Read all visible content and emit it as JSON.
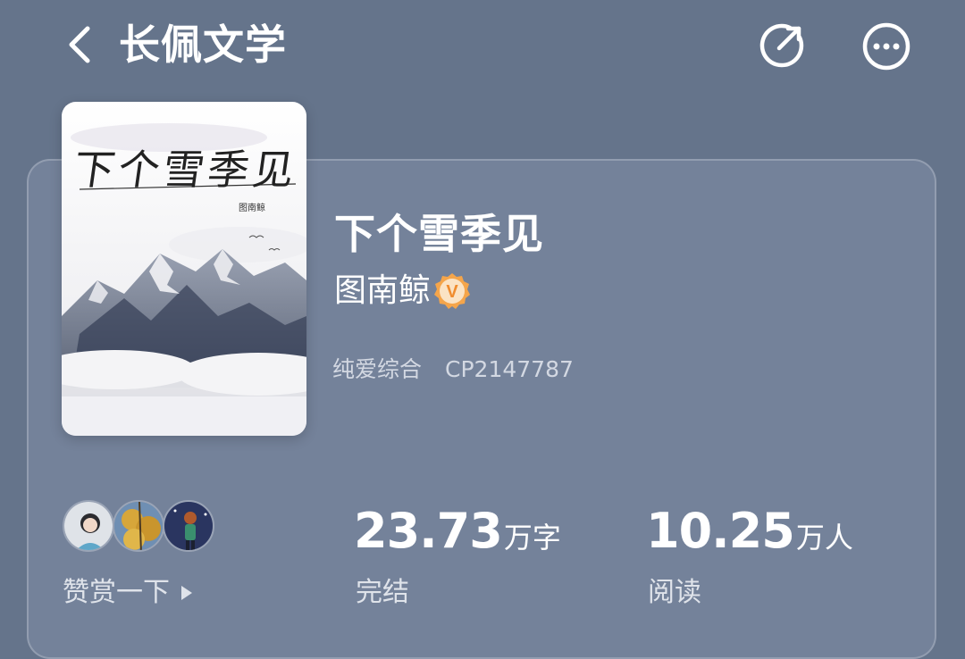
{
  "header": {
    "title": "长佩文学",
    "icons": [
      "back-icon",
      "share-icon",
      "more-icon"
    ]
  },
  "book": {
    "cover": {
      "title_text": "下个雪季见",
      "author_text": "图南鲸"
    },
    "title": "下个雪季见",
    "author": "图南鲸",
    "verified_badge": "V",
    "category": "纯爱综合",
    "cp_id": "CP2147787"
  },
  "stats": {
    "tip": {
      "label": "赞赏一下",
      "avatars": [
        "avatar-1",
        "avatar-2",
        "avatar-3"
      ]
    },
    "words": {
      "value": "23.73",
      "unit": "万字",
      "label": "完结"
    },
    "readers": {
      "value": "10.25",
      "unit": "万人",
      "label": "阅读"
    }
  },
  "colors": {
    "background": "#65748b",
    "card": "#74829a",
    "verified_badge": "#f5a54a"
  }
}
